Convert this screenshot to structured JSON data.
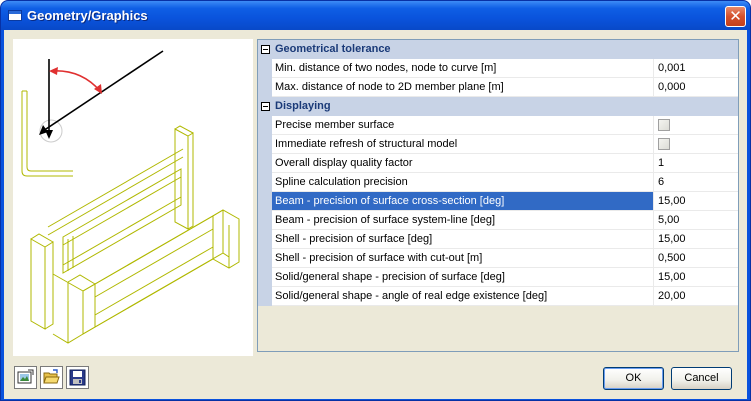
{
  "window": {
    "title": "Geometry/Graphics",
    "close_glyph": "✕"
  },
  "preview": {
    "illustration": "geometry-graphics-preview",
    "colors": {
      "line": "#b0b800",
      "arrow": "#000000",
      "angle_arc": "#e03030"
    }
  },
  "grid": {
    "categories": [
      {
        "label": "Geometrical tolerance",
        "rows": [
          {
            "name": "Min. distance of two nodes, node to curve [m]",
            "value": "0,001"
          },
          {
            "name": "Max. distance of node to 2D member plane [m]",
            "value": "0,000"
          }
        ]
      },
      {
        "label": "Displaying",
        "rows": [
          {
            "name": "Precise member surface",
            "value": "",
            "checkbox": true
          },
          {
            "name": "Immediate refresh of structural model",
            "value": "",
            "checkbox": true
          },
          {
            "name": "Overall display quality factor",
            "value": "1"
          },
          {
            "name": "Spline calculation precision",
            "value": "6"
          },
          {
            "name": "Beam - precision of surface cross-section [deg]",
            "value": "15,00",
            "selected": true
          },
          {
            "name": "Beam - precision of surface system-line [deg]",
            "value": "5,00"
          },
          {
            "name": "Shell - precision of surface [deg]",
            "value": "15,00"
          },
          {
            "name": "Shell - precision of surface with cut-out [m]",
            "value": "0,500"
          },
          {
            "name": "Solid/general shape - precision of surface [deg]",
            "value": "15,00"
          },
          {
            "name": "Solid/general shape - angle of real edge existence [deg]",
            "value": "20,00"
          }
        ]
      }
    ]
  },
  "toolbar": {
    "buttons": [
      "picture-icon",
      "open-folder-icon",
      "save-disk-icon"
    ]
  },
  "buttons": {
    "ok": "OK",
    "cancel": "Cancel"
  },
  "colors": {
    "title_bar": "#0a53dc",
    "selection": "#316ac5",
    "category_bg": "#c8d3e6",
    "client_bg": "#ece9d8"
  }
}
